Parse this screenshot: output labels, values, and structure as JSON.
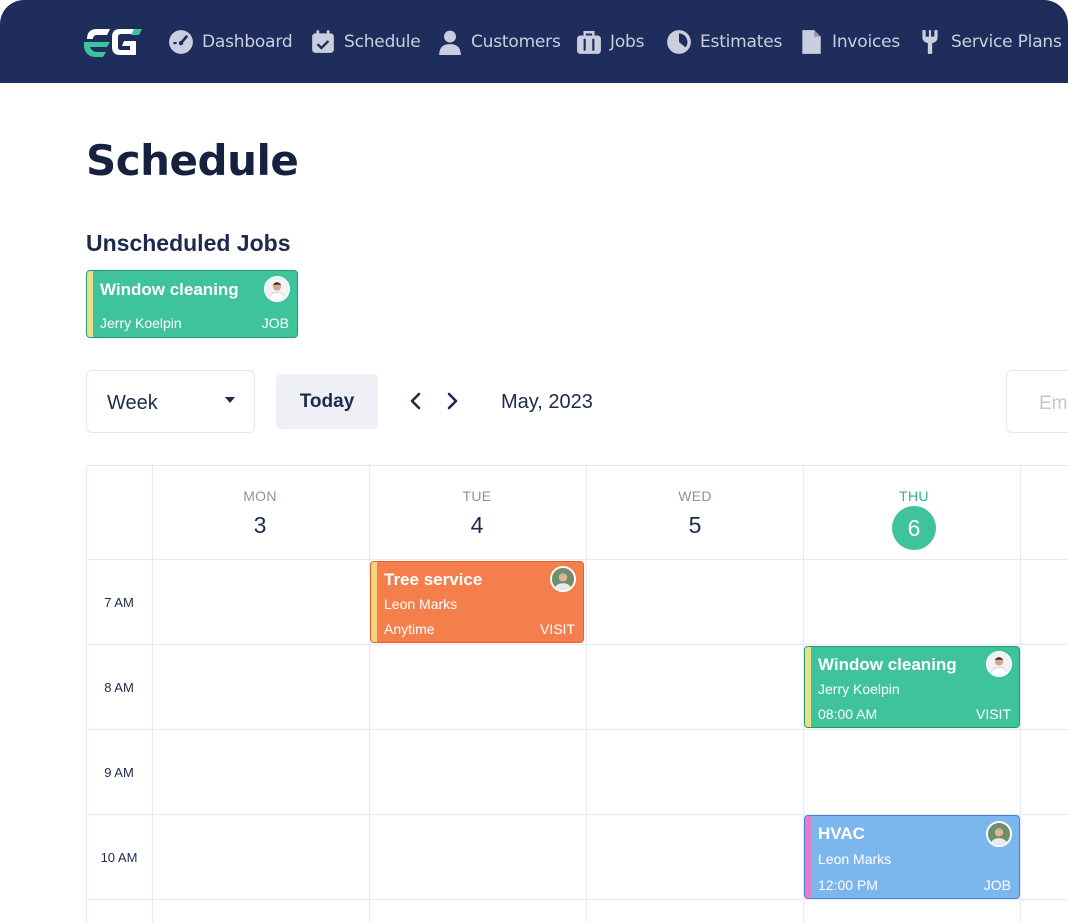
{
  "nav": {
    "items": [
      {
        "label": "Dashboard",
        "icon": "gauge-icon"
      },
      {
        "label": "Schedule",
        "icon": "calendar-check-icon"
      },
      {
        "label": "Customers",
        "icon": "user-icon"
      },
      {
        "label": "Jobs",
        "icon": "briefcase-icon"
      },
      {
        "label": "Estimates",
        "icon": "pie-chart-icon"
      },
      {
        "label": "Invoices",
        "icon": "document-icon"
      },
      {
        "label": "Service Plans",
        "icon": "wrench-icon"
      }
    ]
  },
  "page": {
    "title": "Schedule",
    "unscheduled_title": "Unscheduled Jobs"
  },
  "unscheduled": [
    {
      "title": "Window cleaning",
      "person": "Jerry Koelpin",
      "type": "JOB"
    }
  ],
  "toolbar": {
    "view": "Week",
    "today_label": "Today",
    "month_label": "May, 2023",
    "search_placeholder": "Em"
  },
  "calendar": {
    "days": [
      {
        "name": "MON",
        "num": "3"
      },
      {
        "name": "TUE",
        "num": "4"
      },
      {
        "name": "WED",
        "num": "5"
      },
      {
        "name": "THU",
        "num": "6"
      }
    ],
    "times": [
      "7 AM",
      "8 AM",
      "9 AM",
      "10 AM"
    ],
    "events": [
      {
        "title": "Tree service",
        "person": "Leon Marks",
        "time": "Anytime",
        "type": "VISIT",
        "color": "#f57f4c"
      },
      {
        "title": "Window cleaning",
        "person": "Jerry Koelpin",
        "time": "08:00 AM",
        "type": "VISIT",
        "color": "#3ec39a"
      },
      {
        "title": "HVAC",
        "person": "Leon Marks",
        "time": "12:00 PM",
        "type": "JOB",
        "color": "#7cb6ef"
      }
    ]
  },
  "colors": {
    "nav_bg": "#1f2d5c",
    "accent_green": "#3ec39a"
  }
}
